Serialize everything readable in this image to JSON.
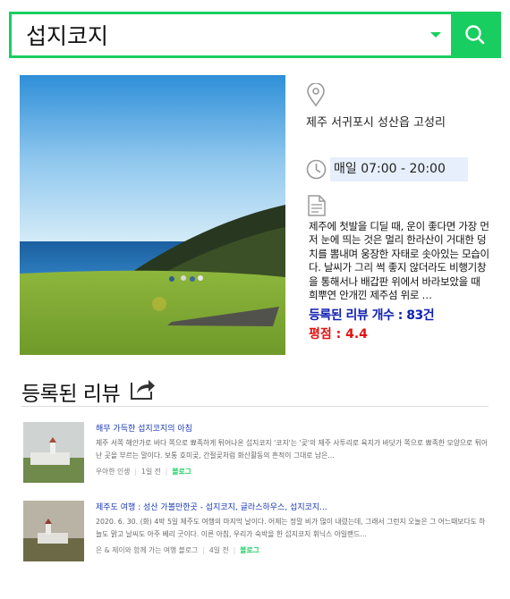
{
  "search": {
    "query": "섭지코지"
  },
  "place": {
    "address": "제주 서귀포시 성산읍 고성리",
    "hours": "매일 07:00 - 20:00",
    "description": "제주에 첫발을 디딜 때, 운이 좋다면 가장 먼저 눈에 띄는 것은 멀리 한라산이 거대한 덩치를 뽐내며 웅장한 자태로 솟아있는 모습이다. 날씨가 그리 썩 좋지 않더라도 비행기창을 통해서나 배갑판 위에서 바라보았을 때 희뿌연 안개낀 제주섬 위로 …",
    "review_count": "등록된 리뷰 개수 : 83건",
    "rating": "평점 : 4.4"
  },
  "reviews": {
    "heading": "등록된 리뷰",
    "items": [
      {
        "title": "해무 가득한 섭지코지의 아침",
        "snippet": "제주 서쪽 해안가로 바다 쪽으로 뾰족하게 튀어나온 섭지코지 '코지'는 '곶'의 제주 사투리로 육지가 바닷가 쪽으로 뾰족한 모양으로 튀어난 곳을 부르는 말이다. 보통 호미곶, 간절곶처럼 화산활동의 흔적이 그대로 남은...",
        "author": "우아한 인생",
        "time": "1일 전",
        "source": "블로그"
      },
      {
        "title": "제주도 여행 : 성산 가볼만한곳 - 섭지코지, 글라스하우스, 섭지코지...",
        "snippet": "2020. 6. 30. (화) 4박 5일 제주도 여행의 마지막 날이다. 어제는 정말 비가 많이 내렸는데, 그래서 그런지 오늘은 그 어느때보다도 하늘도 맑고 날씨도 아주 베리 굿이다. 이른 아침, 우리가 숙박을 한 섭지코지 휘닉스 아일랜드...",
        "author": "은 & 제이와 함께 가는 여행 블로그",
        "time": "4일 전",
        "source": "블로그"
      }
    ]
  },
  "colors": {
    "accent": "#19ce60",
    "count_color": "#1120b4",
    "rating_color": "#e01212"
  }
}
